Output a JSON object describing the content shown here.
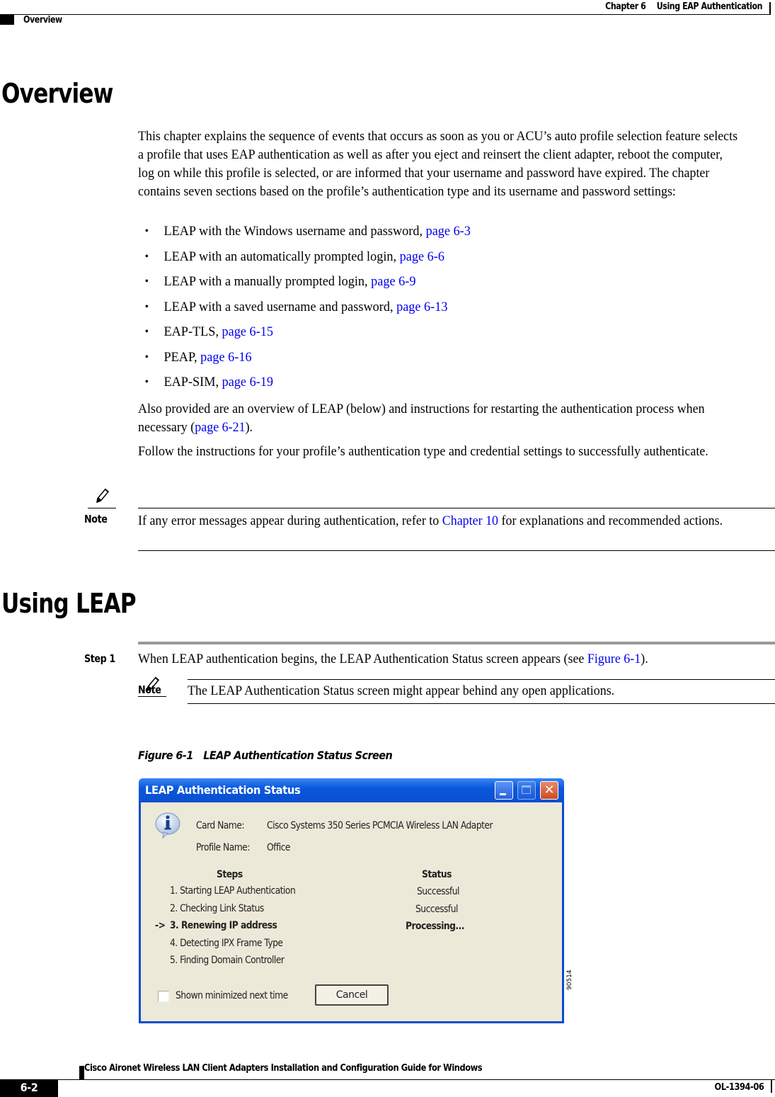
{
  "header": {
    "chapter": "Chapter 6",
    "chapter_title": "Using EAP Authentication",
    "section": "Overview"
  },
  "overview": {
    "heading": "Overview",
    "intro": "This chapter explains the sequence of events that occurs as soon as you or ACU’s auto profile selection feature selects a profile that uses EAP authentication as well as after you eject and reinsert the client adapter, reboot the computer, log on while this profile is selected, or are informed that your username and password have expired. The chapter contains seven sections based on the profile’s authentication type and its username and password settings:",
    "bullets": [
      {
        "text": "LEAP with the Windows username and password, ",
        "link": "page 6-3"
      },
      {
        "text": "LEAP with an automatically prompted login, ",
        "link": "page 6-6"
      },
      {
        "text": "LEAP with a manually prompted login, ",
        "link": "page 6-9"
      },
      {
        "text": "LEAP with a saved username and password, ",
        "link": "page 6-13"
      },
      {
        "text": "EAP-TLS, ",
        "link": "page 6-15"
      },
      {
        "text": "PEAP, ",
        "link": "page 6-16"
      },
      {
        "text": "EAP-SIM, ",
        "link": "page 6-19"
      }
    ],
    "also_pre": "Also provided are an overview of LEAP (below) and instructions for restarting the authentication process when necessary (",
    "also_link": "page 6-21",
    "also_post": ").",
    "follow": "Follow the instructions for your profile’s authentication type and credential settings to successfully authenticate.",
    "note": {
      "label": "Note",
      "pre": "If any error messages appear during authentication, refer to ",
      "link": "Chapter 10",
      "post": " for explanations and recommended actions."
    }
  },
  "using_leap": {
    "heading": "Using LEAP",
    "step_label": "Step 1",
    "step_pre": "When LEAP authentication begins, the LEAP Authentication Status screen appears (see ",
    "step_link": "Figure 6-1",
    "step_post": ").",
    "note": {
      "label": "Note",
      "text": "The LEAP Authentication Status screen might appear behind any open applications."
    },
    "figure": {
      "number": "Figure 6-1",
      "caption": "LEAP Authentication Status Screen",
      "figure_id": "90514"
    }
  },
  "dialog": {
    "title": "LEAP Authentication Status",
    "card_name_label": "Card Name:",
    "card_name_value": "Cisco Systems 350 Series PCMCIA Wireless LAN Adapter",
    "profile_name_label": "Profile Name:",
    "profile_name_value": "Office",
    "steps_header": "Steps",
    "status_header": "Status",
    "steps": [
      {
        "label": "1. Starting LEAP Authentication",
        "status": "Successful",
        "current": false
      },
      {
        "label": "2. Checking Link Status",
        "status": "Successful",
        "current": false
      },
      {
        "label": "3. Renewing IP address",
        "status": "Processing...",
        "current": true
      },
      {
        "label": "4. Detecting IPX Frame Type",
        "status": "",
        "current": false
      },
      {
        "label": "5. Finding Domain Controller",
        "status": "",
        "current": false
      }
    ],
    "current_marker": "->",
    "checkbox_label": "Shown minimized next time",
    "checkbox_checked": false,
    "cancel_label": "Cancel",
    "close_glyph": "✕"
  },
  "footer": {
    "guide_title": "Cisco Aironet Wireless LAN Client Adapters Installation and Configuration Guide for Windows",
    "page": "6-2",
    "doc_number": "OL-1394-06"
  },
  "colors": {
    "link": "#0000ee",
    "titlebar": "#0a58dd",
    "dialog_bg": "#ece9d8"
  }
}
